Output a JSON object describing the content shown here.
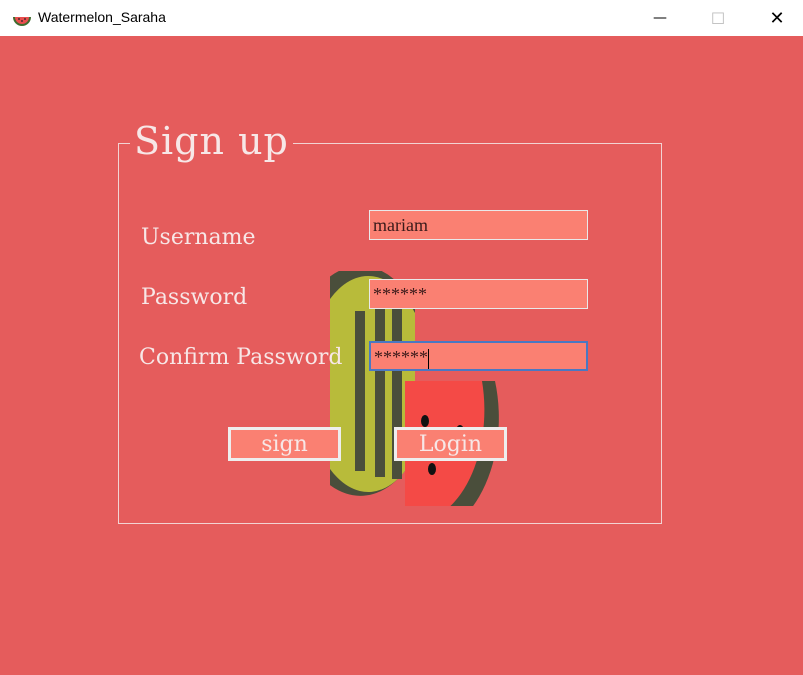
{
  "window": {
    "title": "Watermelon_Saraha",
    "icon": "watermelon-icon",
    "controls": {
      "minimize": "—",
      "maximize": "☐",
      "close": "✕"
    }
  },
  "form": {
    "legend": "Sign up",
    "labels": {
      "username": "Username",
      "password": "Password",
      "confirm_password": "Confirm Password"
    },
    "values": {
      "username": "mariam",
      "password": "******",
      "confirm_password": "******"
    },
    "buttons": {
      "sign": "sign",
      "login": "Login"
    }
  },
  "colors": {
    "background": "#e55c5c",
    "field_bg": "#fa8072",
    "text": "#f7e7e7"
  }
}
